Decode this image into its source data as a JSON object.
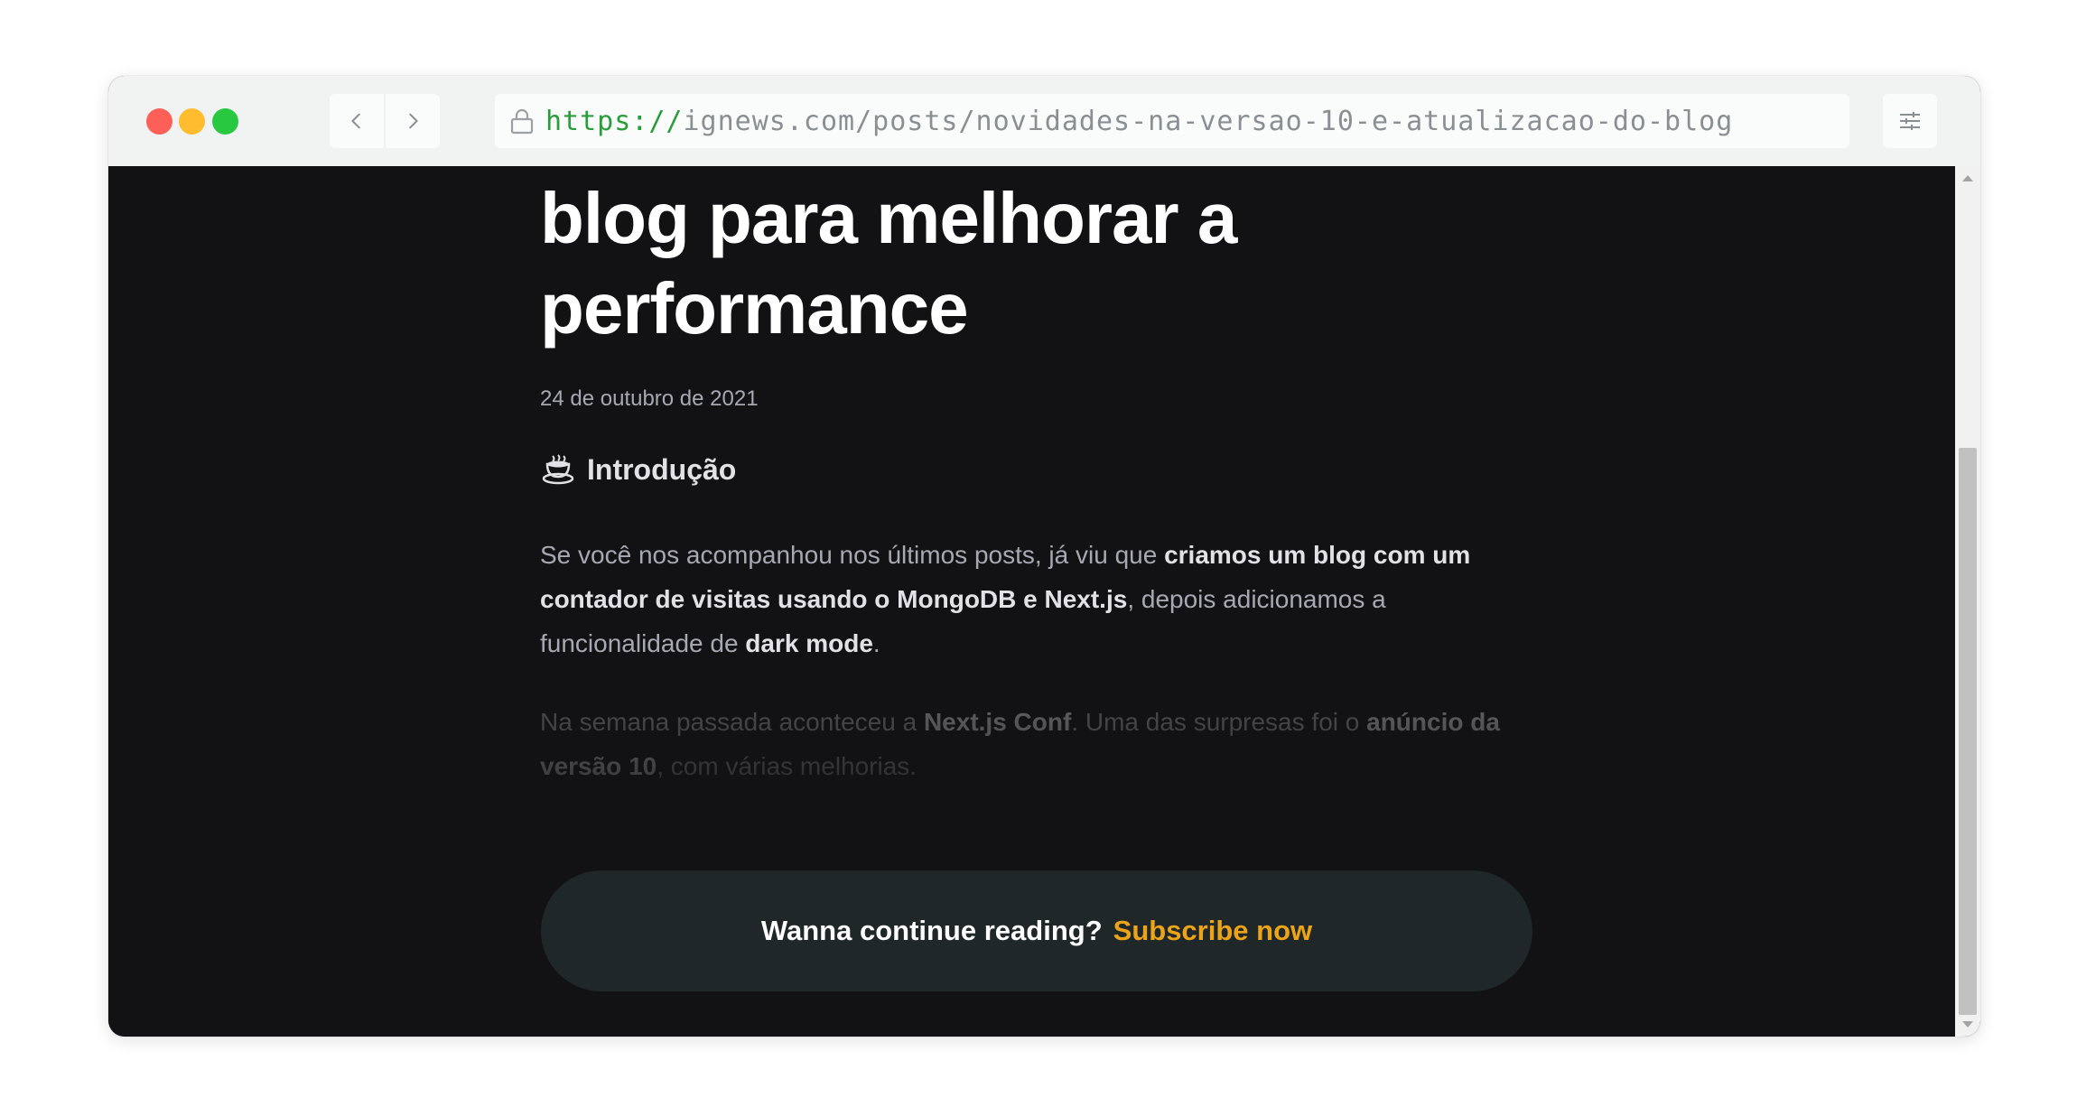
{
  "browser": {
    "url_scheme": "https://",
    "url_rest": "ignews.com/posts/novidades-na-versao-10-e-atualizacao-do-blog"
  },
  "article": {
    "title_line_partial": "",
    "title_line_2": "blog para melhorar a",
    "title_line_3": "performance",
    "date": "24 de outubro de 2021",
    "section_heading": "Introdução",
    "p1": {
      "t1": "Se você nos acompanhou nos últimos posts, já viu que ",
      "b1": "criamos um blog com um contador de visitas usando o MongoDB e Next.js",
      "t2": ", depois adicionamos a funcionalidade de ",
      "b2": "dark mode",
      "t3": "."
    },
    "p2": {
      "t1": "Na semana passada aconteceu a ",
      "b1": "Next.js Conf",
      "t2": ". Uma das surpresas foi o ",
      "b2": "anúncio da versão 10",
      "t3": ", com várias melhorias."
    }
  },
  "cta": {
    "text": "Wanna continue reading?",
    "link": "Subscribe now"
  },
  "colors": {
    "background": "#121214",
    "accent": "#eba417",
    "cta_bg": "#1f2729",
    "url_scheme": "#2a9d3b"
  },
  "icons": [
    "chevron-left-icon",
    "chevron-right-icon",
    "lock-icon",
    "sliders-icon",
    "coffee-cup-icon"
  ]
}
